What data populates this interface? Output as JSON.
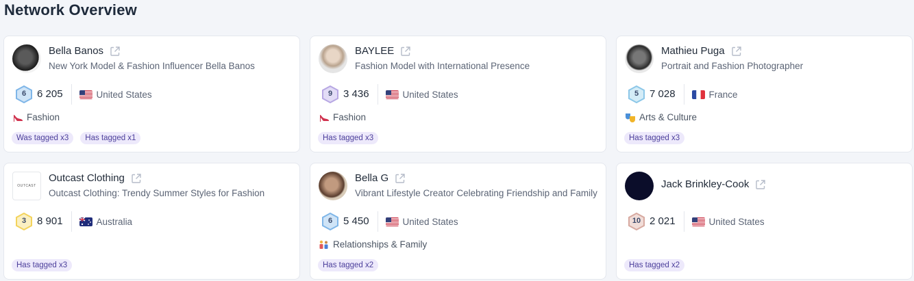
{
  "page_title": "Network Overview",
  "cards": [
    {
      "name": "Bella Banos",
      "description": "New York Model & Fashion Influencer Bella Banos",
      "level": "6",
      "level_color": "#7fb6e8",
      "followers": "6 205",
      "country": "United States",
      "category": "Fashion",
      "category_icon": "high-heel-icon",
      "tags": [
        "Was tagged x3",
        "Has tagged x1"
      ]
    },
    {
      "name": "BAYLEE",
      "description": "Fashion Model with International Presence",
      "level": "9",
      "level_color": "#b7a7e3",
      "followers": "3 436",
      "country": "United States",
      "category": "Fashion",
      "category_icon": "high-heel-icon",
      "tags": [
        "Has tagged x3"
      ]
    },
    {
      "name": "Mathieu Puga",
      "description": "Portrait and Fashion Photographer",
      "level": "5",
      "level_color": "#8cc7e8",
      "followers": "7 028",
      "country": "France",
      "category": "Arts & Culture",
      "category_icon": "theater-masks-icon",
      "tags": [
        "Has tagged x3"
      ]
    },
    {
      "name": "Outcast Clothing",
      "description": "Outcast Clothing: Trendy Summer Styles for Fashion",
      "logo_text": "OUTCAST",
      "level": "3",
      "level_color": "#f3d35c",
      "followers": "8 901",
      "country": "Australia",
      "tags": [
        "Has tagged x3"
      ]
    },
    {
      "name": "Bella G",
      "description": "Vibrant Lifestyle Creator Celebrating Friendship and Family",
      "level": "6",
      "level_color": "#7fb6e8",
      "followers": "5 450",
      "country": "United States",
      "category": "Relationships & Family",
      "category_icon": "family-icon",
      "tags": [
        "Has tagged x2"
      ]
    },
    {
      "name": "Jack Brinkley-Cook",
      "level": "10",
      "level_color": "#d7a9a0",
      "followers": "2 021",
      "country": "United States",
      "tags": [
        "Has tagged x2"
      ]
    }
  ]
}
